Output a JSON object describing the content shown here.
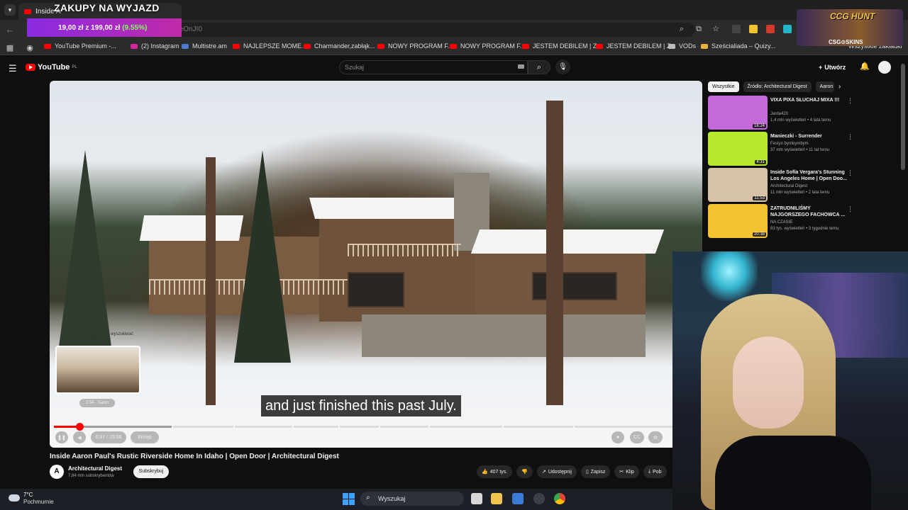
{
  "browser": {
    "tab_title": "Inside A",
    "overlay_title": "ZAKUPY NA WYJAZD",
    "url_fragment": "oCeOnJI0",
    "promo": {
      "text": "19,00 zł z 199,00 zł",
      "percent": "(9.55%)"
    },
    "bookmarks": [
      {
        "label": "YouTube Premium -...",
        "icon": "youtube-icon",
        "color": "#ff0000"
      },
      {
        "label": "(2) Instagram",
        "icon": "instagram-icon",
        "color": "#d6249f"
      },
      {
        "label": "Multistre.am",
        "icon": "multistream-icon",
        "color": "#4a7bd1"
      },
      {
        "label": "NAJLEPSZE MOME...",
        "icon": "youtube-icon",
        "color": "#ff0000"
      },
      {
        "label": "Charmander,zabłąk...",
        "icon": "youtube-icon",
        "color": "#ff0000"
      },
      {
        "label": "NOWY PROGRAM F...",
        "icon": "youtube-icon",
        "color": "#ff0000"
      },
      {
        "label": "NOWY PROGRAM F...",
        "icon": "youtube-icon",
        "color": "#ff0000"
      },
      {
        "label": "JESTEM DEBILEM | Z...",
        "icon": "youtube-icon",
        "color": "#ff0000"
      },
      {
        "label": "JESTEM DEBILEM | Z...",
        "icon": "youtube-icon",
        "color": "#ff0000"
      },
      {
        "label": "VODs",
        "icon": "globe-icon",
        "color": "#bbbbbb"
      },
      {
        "label": "Sześcialiada – Quizy...",
        "icon": "person-icon",
        "color": "#e8b23a"
      }
    ],
    "bookmarks_right": "Wszystkie zakładki"
  },
  "youtube": {
    "logo": "YouTube",
    "logo_region": "PL",
    "search_placeholder": "Szukaj",
    "create_label": "Utwórz"
  },
  "player": {
    "subtitle": "and just finished this past July.",
    "preview_hint": "Podciągnij w górę, aby wyszukiwać precyzyjnie",
    "preview_chapter": "0:54 · Salon",
    "time": "0:37 / 15:08",
    "chapter_label": "Wstęp",
    "played_fraction": 0.041,
    "buffered_fraction": 0.19
  },
  "video": {
    "title": "Inside Aaron Paul's Rustic Riverside Home In Idaho | Open Door | Architectural Digest",
    "channel": "Architectural Digest",
    "channel_initial": "A",
    "subscribers": "7,84 mln subskrybentów",
    "subscribe_label": "Subskrybuj",
    "likes": "407 tys.",
    "share_label": "Udostępnij",
    "save_label": "Zapisz",
    "clip_label": "Klip",
    "download_label": "Pob"
  },
  "sidebar": {
    "chips": [
      "Wszystkie",
      "Źródło: Architectural Digest",
      "Aaron"
    ],
    "suggestions": [
      {
        "title": "VIXA PIXA SŁUCHAJ MIXA !!!",
        "channel": "Jarda420",
        "meta": "1,4 mln wyświetleń • 4 lata temu",
        "duration": "16:24",
        "thumb": "#c46ad8"
      },
      {
        "title": "Manieczki - Surrender",
        "channel": "Festyn bymbymbym",
        "meta": "37 mln wyświetleń • 11 lat temu",
        "duration": "4:31",
        "thumb": "#b7e82e"
      },
      {
        "title": "Inside Sofía Vergara's Stunning Los Angeles Home | Open Doo...",
        "channel": "Architectural Digest",
        "meta": "11 mln wyświetleń • 2 lata temu",
        "duration": "11:53",
        "thumb": "#d7c2a8"
      },
      {
        "title": "ZATRUDNILIŚMY NAJGORSZEGO FACHOWCA ...",
        "channel": "NA CZASIE",
        "meta": "83 tys. wyświetleń • 3 tygodnie temu",
        "duration": "20:38",
        "thumb": "#f2c230"
      }
    ]
  },
  "stream_overlay": {
    "title": "CCG HUNT",
    "sponsor": "CSG⊙SKINS"
  },
  "taskbar": {
    "temperature": "7°C",
    "weather": "Pochmurnie",
    "search_label": "Wyszukaj"
  }
}
